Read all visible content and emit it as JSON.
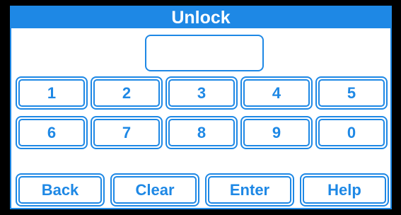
{
  "title": "Unlock",
  "code_display": "",
  "keys": [
    "1",
    "2",
    "3",
    "4",
    "5",
    "6",
    "7",
    "8",
    "9",
    "0"
  ],
  "actions": {
    "back": "Back",
    "clear": "Clear",
    "enter": "Enter",
    "help": "Help"
  },
  "colors": {
    "accent": "#1e88e5",
    "background": "#ffffff",
    "frame": "#000000"
  }
}
